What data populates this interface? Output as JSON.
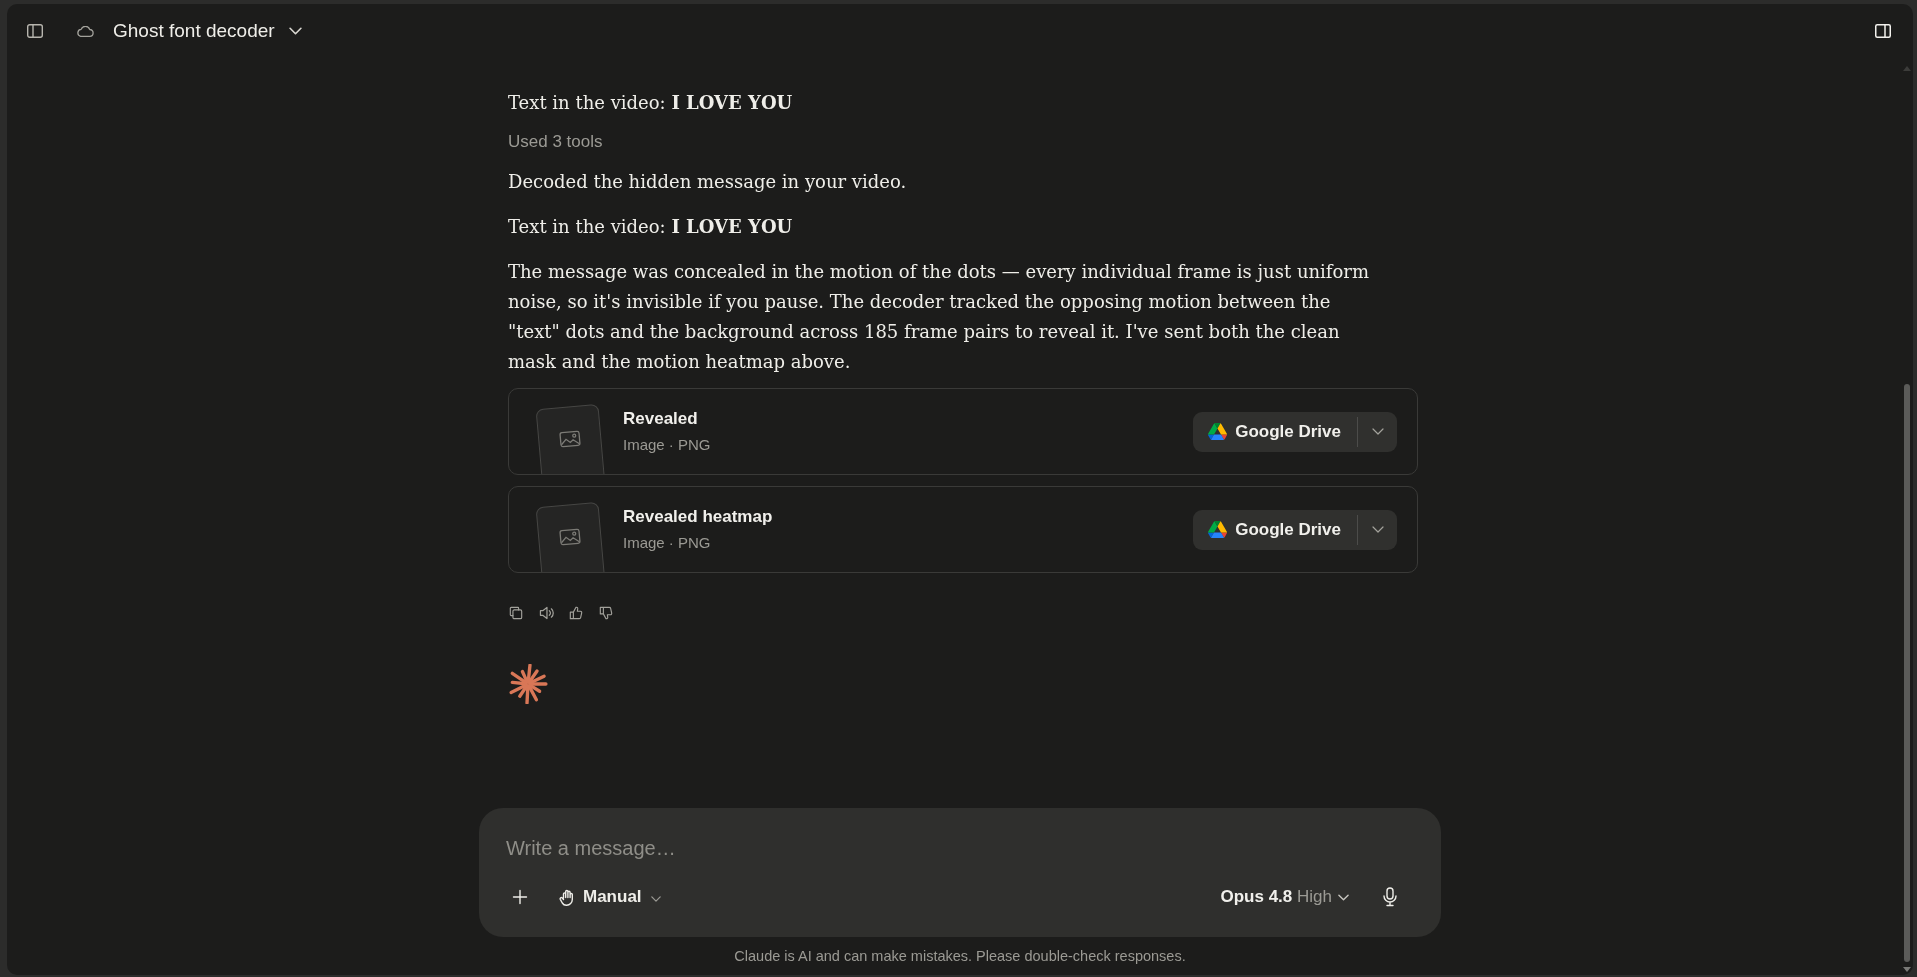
{
  "top_bar": {
    "title": "Ghost font decoder"
  },
  "thread": {
    "blocks": [
      {
        "kind": "paragraph",
        "text": "Text in the video: **I LOVE YOU**"
      },
      {
        "kind": "tool_summary",
        "text": "Used 3 tools"
      },
      {
        "kind": "paragraph",
        "text": "Decoded the hidden message in your video."
      },
      {
        "kind": "paragraph",
        "text": "Text in the video: **I LOVE YOU**"
      },
      {
        "kind": "paragraph",
        "text": "The message was concealed in the motion of the dots — every individual frame is just uniform noise, so it's invisible if you pause. The decoder tracked the opposing motion between the \"text\" dots and the background across 185 frame pairs to reveal it. I've sent both the clean mask and the motion heatmap above."
      }
    ],
    "attachments": [
      {
        "title": "Revealed",
        "meta": "Image · PNG",
        "action": "Google Drive"
      },
      {
        "title": "Revealed heatmap",
        "meta": "Image · PNG",
        "action": "Google Drive"
      }
    ]
  },
  "composer": {
    "placeholder": "Write a message…",
    "mode": "Manual",
    "model": "Opus 4.8",
    "effort": "High"
  },
  "disclaimer": "Claude is AI and can make mistakes. Please double-check responses."
}
